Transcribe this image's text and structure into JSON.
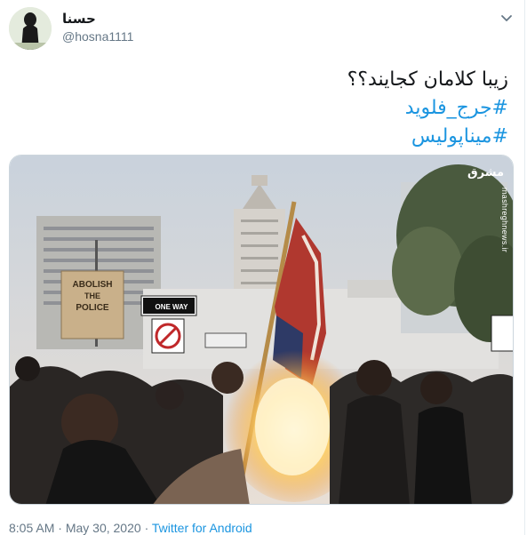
{
  "user": {
    "display_name": "حسنا",
    "handle": "@hosna1111"
  },
  "tweet": {
    "text": "زیبا کلامان کجایند؟؟",
    "hashtags": [
      "#جرج_فلوید",
      "#میناپولیس"
    ]
  },
  "media": {
    "watermark_logo": "مشرق",
    "watermark_url": "mashreghnews.ir",
    "signs": {
      "protest_line1": "ABOLISH",
      "protest_line2": "THE",
      "protest_line3": "POLICE",
      "street_sign": "ONE WAY"
    }
  },
  "meta": {
    "time": "8:05 AM",
    "separator": "·",
    "date": "May 30, 2020",
    "source": "Twitter for Android"
  },
  "colors": {
    "link": "#1b95e0",
    "text": "#14171a",
    "secondary": "#657786"
  },
  "icons": {
    "menu": "chevron-down-icon"
  }
}
